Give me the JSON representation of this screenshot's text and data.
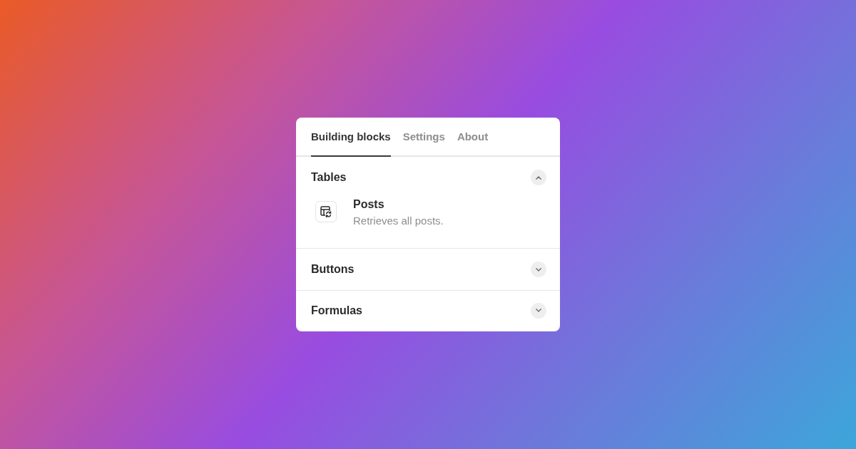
{
  "tabs": [
    {
      "label": "Building blocks",
      "selected": true
    },
    {
      "label": "Settings",
      "selected": false
    },
    {
      "label": "About",
      "selected": false
    }
  ],
  "sections": [
    {
      "title": "Tables",
      "expanded": true,
      "items": [
        {
          "title": "Posts",
          "description": "Retrieves all posts."
        }
      ]
    },
    {
      "title": "Buttons",
      "expanded": false
    },
    {
      "title": "Formulas",
      "expanded": false
    }
  ]
}
